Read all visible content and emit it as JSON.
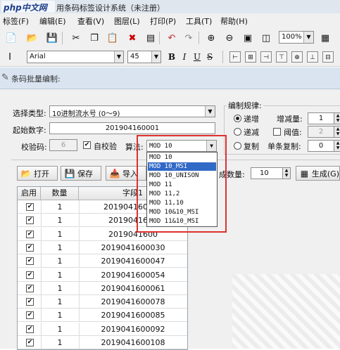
{
  "window": {
    "logo_text": "php中文网",
    "title": "用条码标签设计系统（未注册）"
  },
  "menu": [
    "标签(F)",
    "编辑(E)",
    "查看(V)",
    "图层(L)",
    "打印(P)",
    "工具(T)",
    "帮助(H)"
  ],
  "toolbar": {
    "zoom": "100%"
  },
  "format_bar": {
    "font": "Arial",
    "size": "45",
    "bold": "B",
    "italic": "I",
    "underline": "U",
    "strike": "S"
  },
  "dialog": {
    "title": "条码批量编制:",
    "select_type_label": "选择类型:",
    "select_type_value": "10进制流水号 (0～9)",
    "start_label": "起始数字:",
    "start_value": "201904160001",
    "check_label": "校验码:",
    "check_value": "6",
    "auto_check_label": "自校验",
    "algo_label": "算法:",
    "algo_value": "MOD 10",
    "rules_label": "编制规律:",
    "inc_label": "递增",
    "dec_label": "递减",
    "copy_label": "复制",
    "step_label": "增减量:",
    "step_value": "1",
    "threshold_label": "阈值:",
    "threshold_value": "2",
    "single_copy_label": "单条复制:",
    "single_copy_value": "0",
    "open_label": "打开",
    "save_label": "保存",
    "import_label": "导入",
    "gen_count_label": "成数量:",
    "gen_count_value": "10",
    "generate_label": "生成(G)"
  },
  "algo_options": [
    "MOD 10",
    "MOD 10_MSI",
    "MOD 10_UNISON",
    "MOD 11",
    "MOD 11,2",
    "MOD 11,10",
    "MOD 10&10_MSI",
    "MOD 11&10_MSI"
  ],
  "algo_selected": "MOD 10_MSI",
  "table": {
    "headers": [
      "启用",
      "数量",
      "字段1"
    ],
    "rows": [
      {
        "enabled": "✔",
        "qty": "1",
        "value": "201904160001"
      },
      {
        "enabled": "✔",
        "qty": "1",
        "value": "2019041600"
      },
      {
        "enabled": "✔",
        "qty": "1",
        "value": "2019041600"
      },
      {
        "enabled": "✔",
        "qty": "1",
        "value": "2019041600030"
      },
      {
        "enabled": "✔",
        "qty": "1",
        "value": "2019041600047"
      },
      {
        "enabled": "✔",
        "qty": "1",
        "value": "2019041600054"
      },
      {
        "enabled": "✔",
        "qty": "1",
        "value": "2019041600061"
      },
      {
        "enabled": "✔",
        "qty": "1",
        "value": "2019041600078"
      },
      {
        "enabled": "✔",
        "qty": "1",
        "value": "2019041600085"
      },
      {
        "enabled": "✔",
        "qty": "1",
        "value": "2019041600092"
      },
      {
        "enabled": "✔",
        "qty": "1",
        "value": "2019041600108"
      }
    ]
  }
}
